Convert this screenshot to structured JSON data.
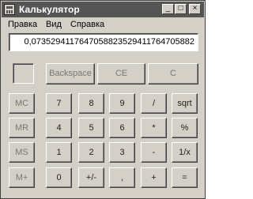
{
  "window": {
    "title": "Калькулятор"
  },
  "caption_buttons": {
    "minimize": "_",
    "maximize": "□",
    "close": "×"
  },
  "menu": [
    "Правка",
    "Вид",
    "Справка"
  ],
  "display": {
    "value": "0,0735294117647058823529411764705882"
  },
  "top_buttons": [
    "Backspace",
    "CE",
    "C"
  ],
  "memory_buttons": [
    "MC",
    "MR",
    "MS",
    "M+"
  ],
  "rows": [
    [
      "7",
      "8",
      "9",
      "/",
      "sqrt"
    ],
    [
      "4",
      "5",
      "6",
      "*",
      "%"
    ],
    [
      "1",
      "2",
      "3",
      "-",
      "1/x"
    ],
    [
      "0",
      "+/-",
      ",",
      "+",
      "="
    ]
  ]
}
